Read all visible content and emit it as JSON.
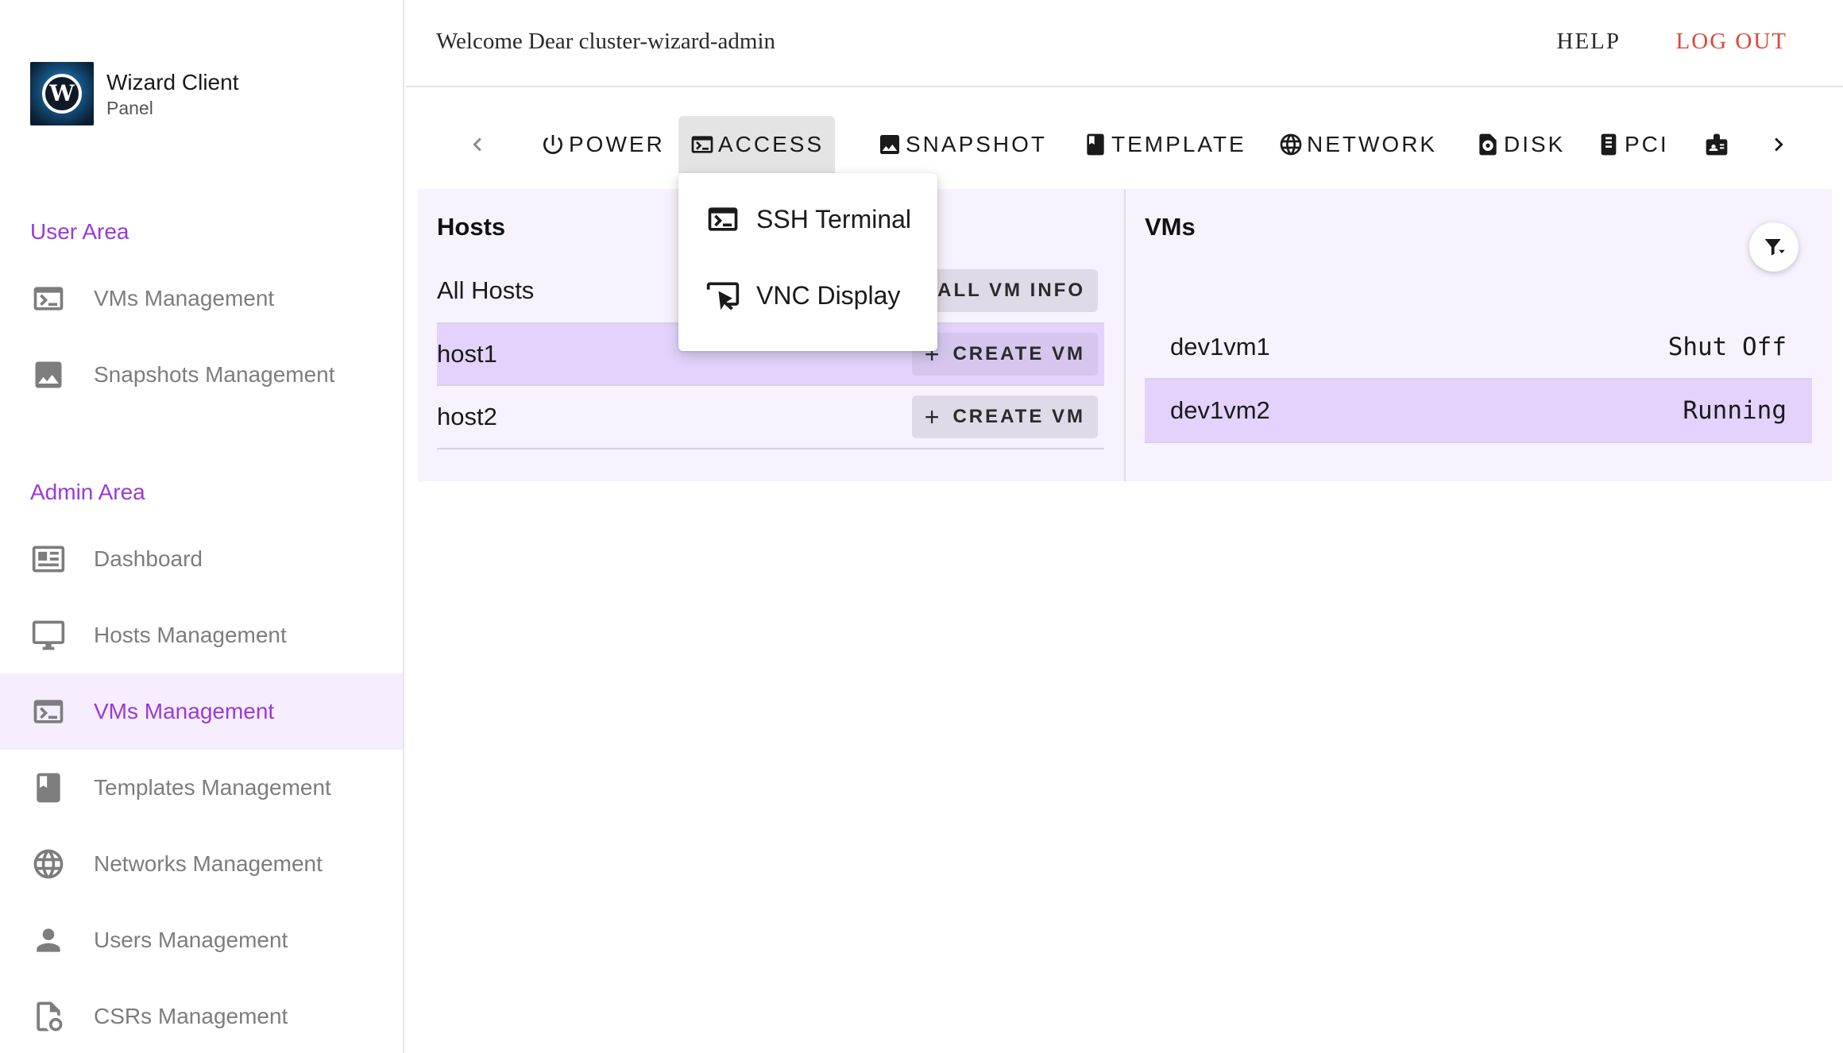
{
  "brand": {
    "title": "Wizard Client",
    "subtitle": "Panel",
    "logo_letter": "W"
  },
  "sidebar": {
    "user_area_title": "User Area",
    "admin_area_title": "Admin Area",
    "user_items": [
      {
        "label": "VMs Management",
        "icon": "terminal-icon"
      },
      {
        "label": "Snapshots Management",
        "icon": "image-icon"
      }
    ],
    "admin_items": [
      {
        "label": "Dashboard",
        "icon": "dashboard-icon"
      },
      {
        "label": "Hosts Management",
        "icon": "monitor-icon"
      },
      {
        "label": "VMs Management",
        "icon": "terminal-icon",
        "active": true
      },
      {
        "label": "Templates Management",
        "icon": "bookmark-icon"
      },
      {
        "label": "Networks Management",
        "icon": "globe-icon"
      },
      {
        "label": "Users Management",
        "icon": "person-icon"
      },
      {
        "label": "CSRs Management",
        "icon": "certificate-icon"
      }
    ]
  },
  "header": {
    "welcome": "Welcome Dear cluster-wizard-admin",
    "help": "HELP",
    "logout": "LOG OUT"
  },
  "tabs": [
    {
      "label": "POWER",
      "icon": "power-icon"
    },
    {
      "label": "ACCESS",
      "icon": "terminal-icon",
      "open": true
    },
    {
      "label": "SNAPSHOT",
      "icon": "image-icon"
    },
    {
      "label": "TEMPLATE",
      "icon": "bookmark-icon"
    },
    {
      "label": "NETWORK",
      "icon": "globe-icon"
    },
    {
      "label": "DISK",
      "icon": "disk-icon"
    },
    {
      "label": "PCI",
      "icon": "chip-icon"
    },
    {
      "label": "",
      "icon": "badge-icon"
    }
  ],
  "access_menu": [
    {
      "label": "SSH Terminal",
      "icon": "terminal-icon"
    },
    {
      "label": "VNC Display",
      "icon": "cast-cursor-icon"
    }
  ],
  "hosts": {
    "title": "Hosts",
    "all_label": "All Hosts",
    "all_button": "E ALL VM INFO",
    "rows": [
      {
        "name": "host1",
        "button": "CREATE VM",
        "selected": true
      },
      {
        "name": "host2",
        "button": "CREATE VM",
        "selected": false
      }
    ]
  },
  "vms": {
    "title": "VMs",
    "rows": [
      {
        "name": "dev1vm1",
        "status": "Shut Off",
        "selected": false
      },
      {
        "name": "dev1vm2",
        "status": "Running",
        "selected": true
      }
    ]
  },
  "colors": {
    "accent": "#9a3ad8",
    "logout": "#d64b3c",
    "selected_row": "#e3d3fc",
    "panel_bg": "#f7f2fd"
  }
}
